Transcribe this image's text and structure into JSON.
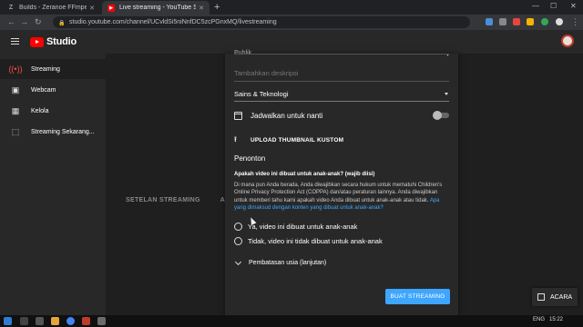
{
  "browser": {
    "tabs": [
      {
        "title": "Builds - Zeranoe FFmpeg",
        "favicon": "Z"
      },
      {
        "title": "Live streaming - YouTube Studio",
        "favicon": "▶"
      }
    ],
    "new_tab": "+",
    "window_controls": {
      "minimize": "—",
      "maximize": "☐",
      "close": "✕"
    },
    "url": "studio.youtube.com/channel/UCvldSi5niNnfDC5zcPGnxMQ/livestreaming"
  },
  "studio": {
    "logo_text": "Studio"
  },
  "sidebar": {
    "items": [
      {
        "label": "Streaming",
        "icon": "broadcast-icon"
      },
      {
        "label": "Webcam",
        "icon": "camera-icon"
      },
      {
        "label": "Kelola",
        "icon": "calendar-icon"
      },
      {
        "label": "Streaming Sekarang...",
        "icon": "stream-now-icon"
      }
    ]
  },
  "main": {
    "background_tabs": [
      "SETELAN STREAMING",
      "ANALY"
    ]
  },
  "dialog": {
    "cut_field_text": "Publik",
    "description_placeholder": "Tambahkan deskripsi",
    "category": "Sains & Teknologi",
    "schedule_label": "Jadwalkan untuk nanti",
    "upload_thumbnail": "UPLOAD THUMBNAIL KUSTOM",
    "audience_title": "Penonton",
    "question": "Apakah video ini dibuat untuk anak-anak? (wajib diisi)",
    "paragraph_main": "Di mana pun Anda berada, Anda diwajibkan secara hukum untuk mematuhi Children's Online Privacy Protection Act (COPPA) dan/atau peraturan lainnya. Anda diwajibkan untuk memberi tahu kami apakah video Anda dibuat untuk anak-anak atau tidak. ",
    "paragraph_link": "Apa yang dimaksud dengan konten yang dibuat untuk anak-anak?",
    "radio_yes": "Ya, video ini dibuat untuk anak-anak",
    "radio_no": "Tidak, video ini tidak dibuat untuk anak-anak",
    "age_restriction": "Pembatasan usia (lanjutan)",
    "create_button": "BUAT STREAMING"
  },
  "events_button": "ACARA",
  "taskbar": {
    "language": "ENG",
    "time": "15:22"
  },
  "colors": {
    "accent_blue": "#3ea6ff",
    "youtube_red": "#ff0000",
    "dialog_bg": "#282828",
    "page_bg": "#1f1f1f"
  }
}
